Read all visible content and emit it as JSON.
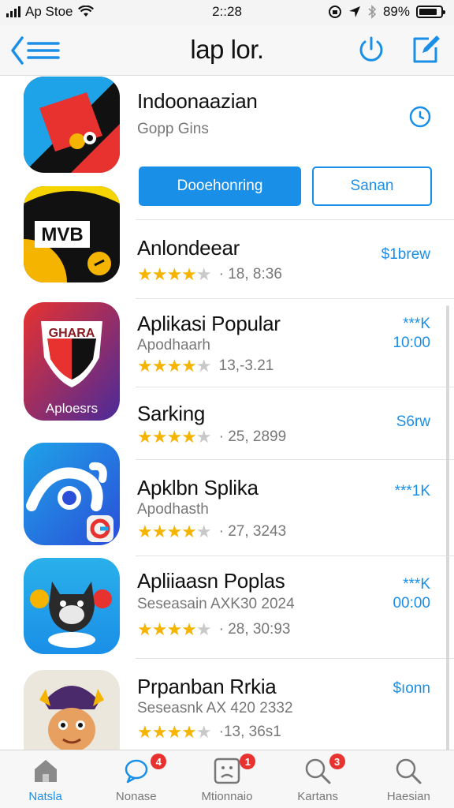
{
  "status_bar": {
    "carrier": "Ap Stoe",
    "time": "2::28",
    "battery": "89%"
  },
  "nav": {
    "title": "lap lor."
  },
  "colors": {
    "accent": "#1a8fe8",
    "star": "#f5b400",
    "badge": "#e8322f"
  },
  "featured": {
    "name": "Indoonaazian",
    "subtitle": "Gopp Gins",
    "primary_button": "Dooehonring",
    "secondary_button": "Sanan",
    "icon": "clock-icon"
  },
  "apps": [
    {
      "name": "Anlondeear",
      "subtitle": "",
      "rating": 4.5,
      "rating_count": "· 18, 8:36",
      "price_line1": "$1brew",
      "price_line2": "",
      "icon_text": "MVB"
    },
    {
      "name": "Aplikasi Popular",
      "subtitle": "Apodhaarh",
      "rating": 4.5,
      "rating_count": "13,-3.21",
      "price_line1": "***K",
      "price_line2": "10:00",
      "icon_text": "GHARA",
      "icon_caption": "Aploesrs"
    },
    {
      "name": "Sarking",
      "subtitle": "",
      "rating": 4.5,
      "rating_count": "· 25, 2899",
      "price_line1": "S6rw",
      "price_line2": ""
    },
    {
      "name": "Apklbn Splika",
      "subtitle": "Apodhasth",
      "rating": 4.5,
      "rating_count": "· 27, 3243",
      "price_line1": "***1K",
      "price_line2": ""
    },
    {
      "name": "Apliiaasn Poplas",
      "subtitle": "Seseasain  AXK30  2024",
      "rating": 4.5,
      "rating_count": "· 28, 30:93",
      "price_line1": "***K",
      "price_line2": "00:00"
    },
    {
      "name": "Prpanban Rrkia",
      "subtitle": "Seseasnk  AX 420 2332",
      "rating": 4.5,
      "rating_count": "·13, 36s1",
      "price_line1": "$ıonn",
      "price_line2": ""
    }
  ],
  "tabs": [
    {
      "label": "Natsla",
      "icon": "home-icon",
      "active": true,
      "badge": ""
    },
    {
      "label": "Nonase",
      "icon": "chat-bubble-icon",
      "active": false,
      "badge": "4"
    },
    {
      "label": "Mtionnaio",
      "icon": "face-icon",
      "active": false,
      "badge": "1"
    },
    {
      "label": "Kartans",
      "icon": "search-icon",
      "active": false,
      "badge": "3"
    },
    {
      "label": "Haesian",
      "icon": "search-icon",
      "active": false,
      "badge": ""
    }
  ]
}
